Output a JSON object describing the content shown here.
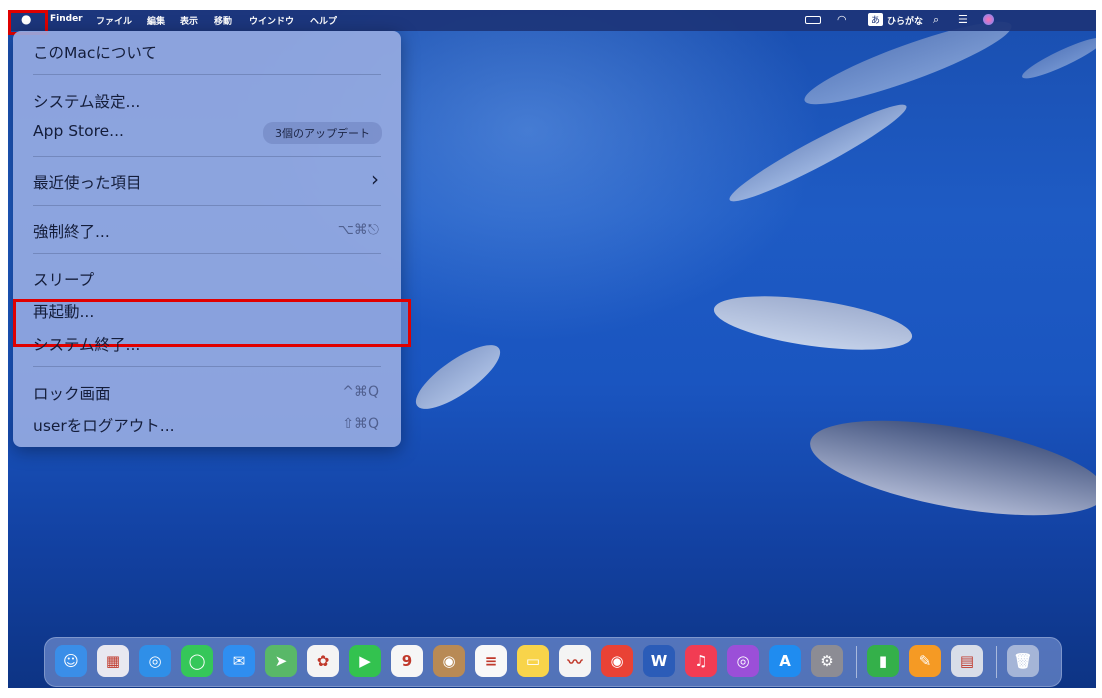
{
  "menubar": {
    "apple_icon": "apple-logo-icon",
    "items": [
      "Finder",
      "ファイル",
      "編集",
      "表示",
      "移動",
      "ウインドウ",
      "ヘルプ"
    ],
    "input_method_badge": "あ",
    "input_method_label": "ひらがな",
    "status_icons": [
      "battery-icon",
      "wifi-icon",
      "search-icon",
      "control-center-icon",
      "siri-icon"
    ]
  },
  "apple_menu": {
    "about": "このMacについて",
    "system_settings": "システム設定...",
    "app_store": "App Store...",
    "app_store_badge": "3個のアップデート",
    "recent_items": "最近使った項目",
    "recent_items_arrow": "›",
    "force_quit": "強制終了...",
    "force_quit_shortcut": "⌥⌘⎋",
    "sleep": "スリープ",
    "restart": "再起動...",
    "shutdown": "システム終了...",
    "lock_screen": "ロック画面",
    "lock_screen_shortcut": "^⌘Q",
    "logout": "userをログアウト...",
    "logout_shortcut": "⇧⌘Q"
  },
  "dock": {
    "apps": [
      {
        "name": "finder-icon",
        "glyph": "☺",
        "color": "#3a8ee8"
      },
      {
        "name": "launchpad-icon",
        "glyph": "▦",
        "color": "#e8e8f0"
      },
      {
        "name": "safari-icon",
        "glyph": "◎",
        "color": "#2f8fe8"
      },
      {
        "name": "messages-icon",
        "glyph": "◯",
        "color": "#35c759"
      },
      {
        "name": "mail-icon",
        "glyph": "✉",
        "color": "#2f8ef0"
      },
      {
        "name": "maps-icon",
        "glyph": "➤",
        "color": "#59b868"
      },
      {
        "name": "photos-icon",
        "glyph": "✿",
        "color": "#f4f4f4"
      },
      {
        "name": "facetime-icon",
        "glyph": "▶",
        "color": "#33c24f"
      },
      {
        "name": "calendar-icon",
        "glyph": "9",
        "color": "#f6f6f6"
      },
      {
        "name": "contacts-icon",
        "glyph": "◉",
        "color": "#b88a55"
      },
      {
        "name": "reminders-icon",
        "glyph": "≡",
        "color": "#f8f8f8"
      },
      {
        "name": "notes-icon",
        "glyph": "▭",
        "color": "#f8d44a"
      },
      {
        "name": "freeform-icon",
        "glyph": "〰",
        "color": "#f4f4f4"
      },
      {
        "name": "chrome-icon",
        "glyph": "◉",
        "color": "#e94235"
      },
      {
        "name": "word-icon",
        "glyph": "W",
        "color": "#2b5cb8"
      },
      {
        "name": "music-icon",
        "glyph": "♫",
        "color": "#f23c53"
      },
      {
        "name": "podcasts-icon",
        "glyph": "◎",
        "color": "#9b4fd8"
      },
      {
        "name": "app-store-icon",
        "glyph": "A",
        "color": "#1f8cf0"
      },
      {
        "name": "system-settings-icon",
        "glyph": "⚙",
        "color": "#8c8c94"
      },
      {
        "name": "numbers-icon",
        "glyph": "▮",
        "color": "#34b04a"
      },
      {
        "name": "pages-icon",
        "glyph": "✎",
        "color": "#f59a24"
      },
      {
        "name": "preview-icon",
        "glyph": "▤",
        "color": "#d8dde8"
      },
      {
        "name": "trash-icon",
        "glyph": "🗑",
        "color": "rgba(220,225,235,0.6)"
      }
    ]
  }
}
